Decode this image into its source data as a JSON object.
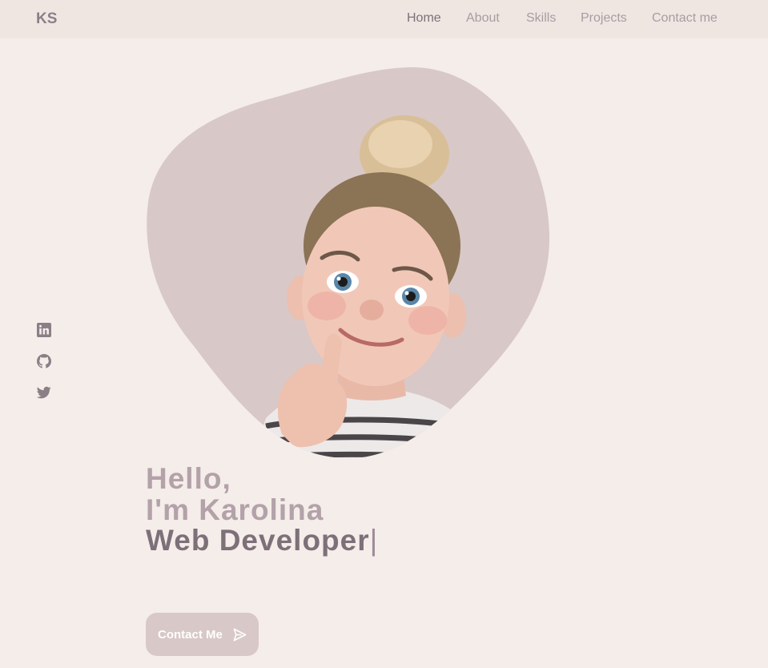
{
  "header": {
    "logo": "KS",
    "nav": [
      {
        "label": "Home",
        "active": true
      },
      {
        "label": "About",
        "active": false
      },
      {
        "label": "Skills",
        "active": false
      },
      {
        "label": "Projects",
        "active": false
      },
      {
        "label": "Contact me",
        "active": false
      }
    ]
  },
  "social": [
    {
      "icon": "linkedin-icon"
    },
    {
      "icon": "github-icon"
    },
    {
      "icon": "twitter-icon"
    }
  ],
  "hero": {
    "line1": "Hello,",
    "line2": "I'm Karolina",
    "line3": "Web Developer",
    "cursor": "|",
    "button_label": "Contact Me",
    "button_icon": "send-icon"
  },
  "colors": {
    "background": "#f5ede9",
    "header_bg": "#efe6e2",
    "blob": "#d8c8c8",
    "accent_text": "#7d7079",
    "muted_text": "#b3a2a9"
  }
}
